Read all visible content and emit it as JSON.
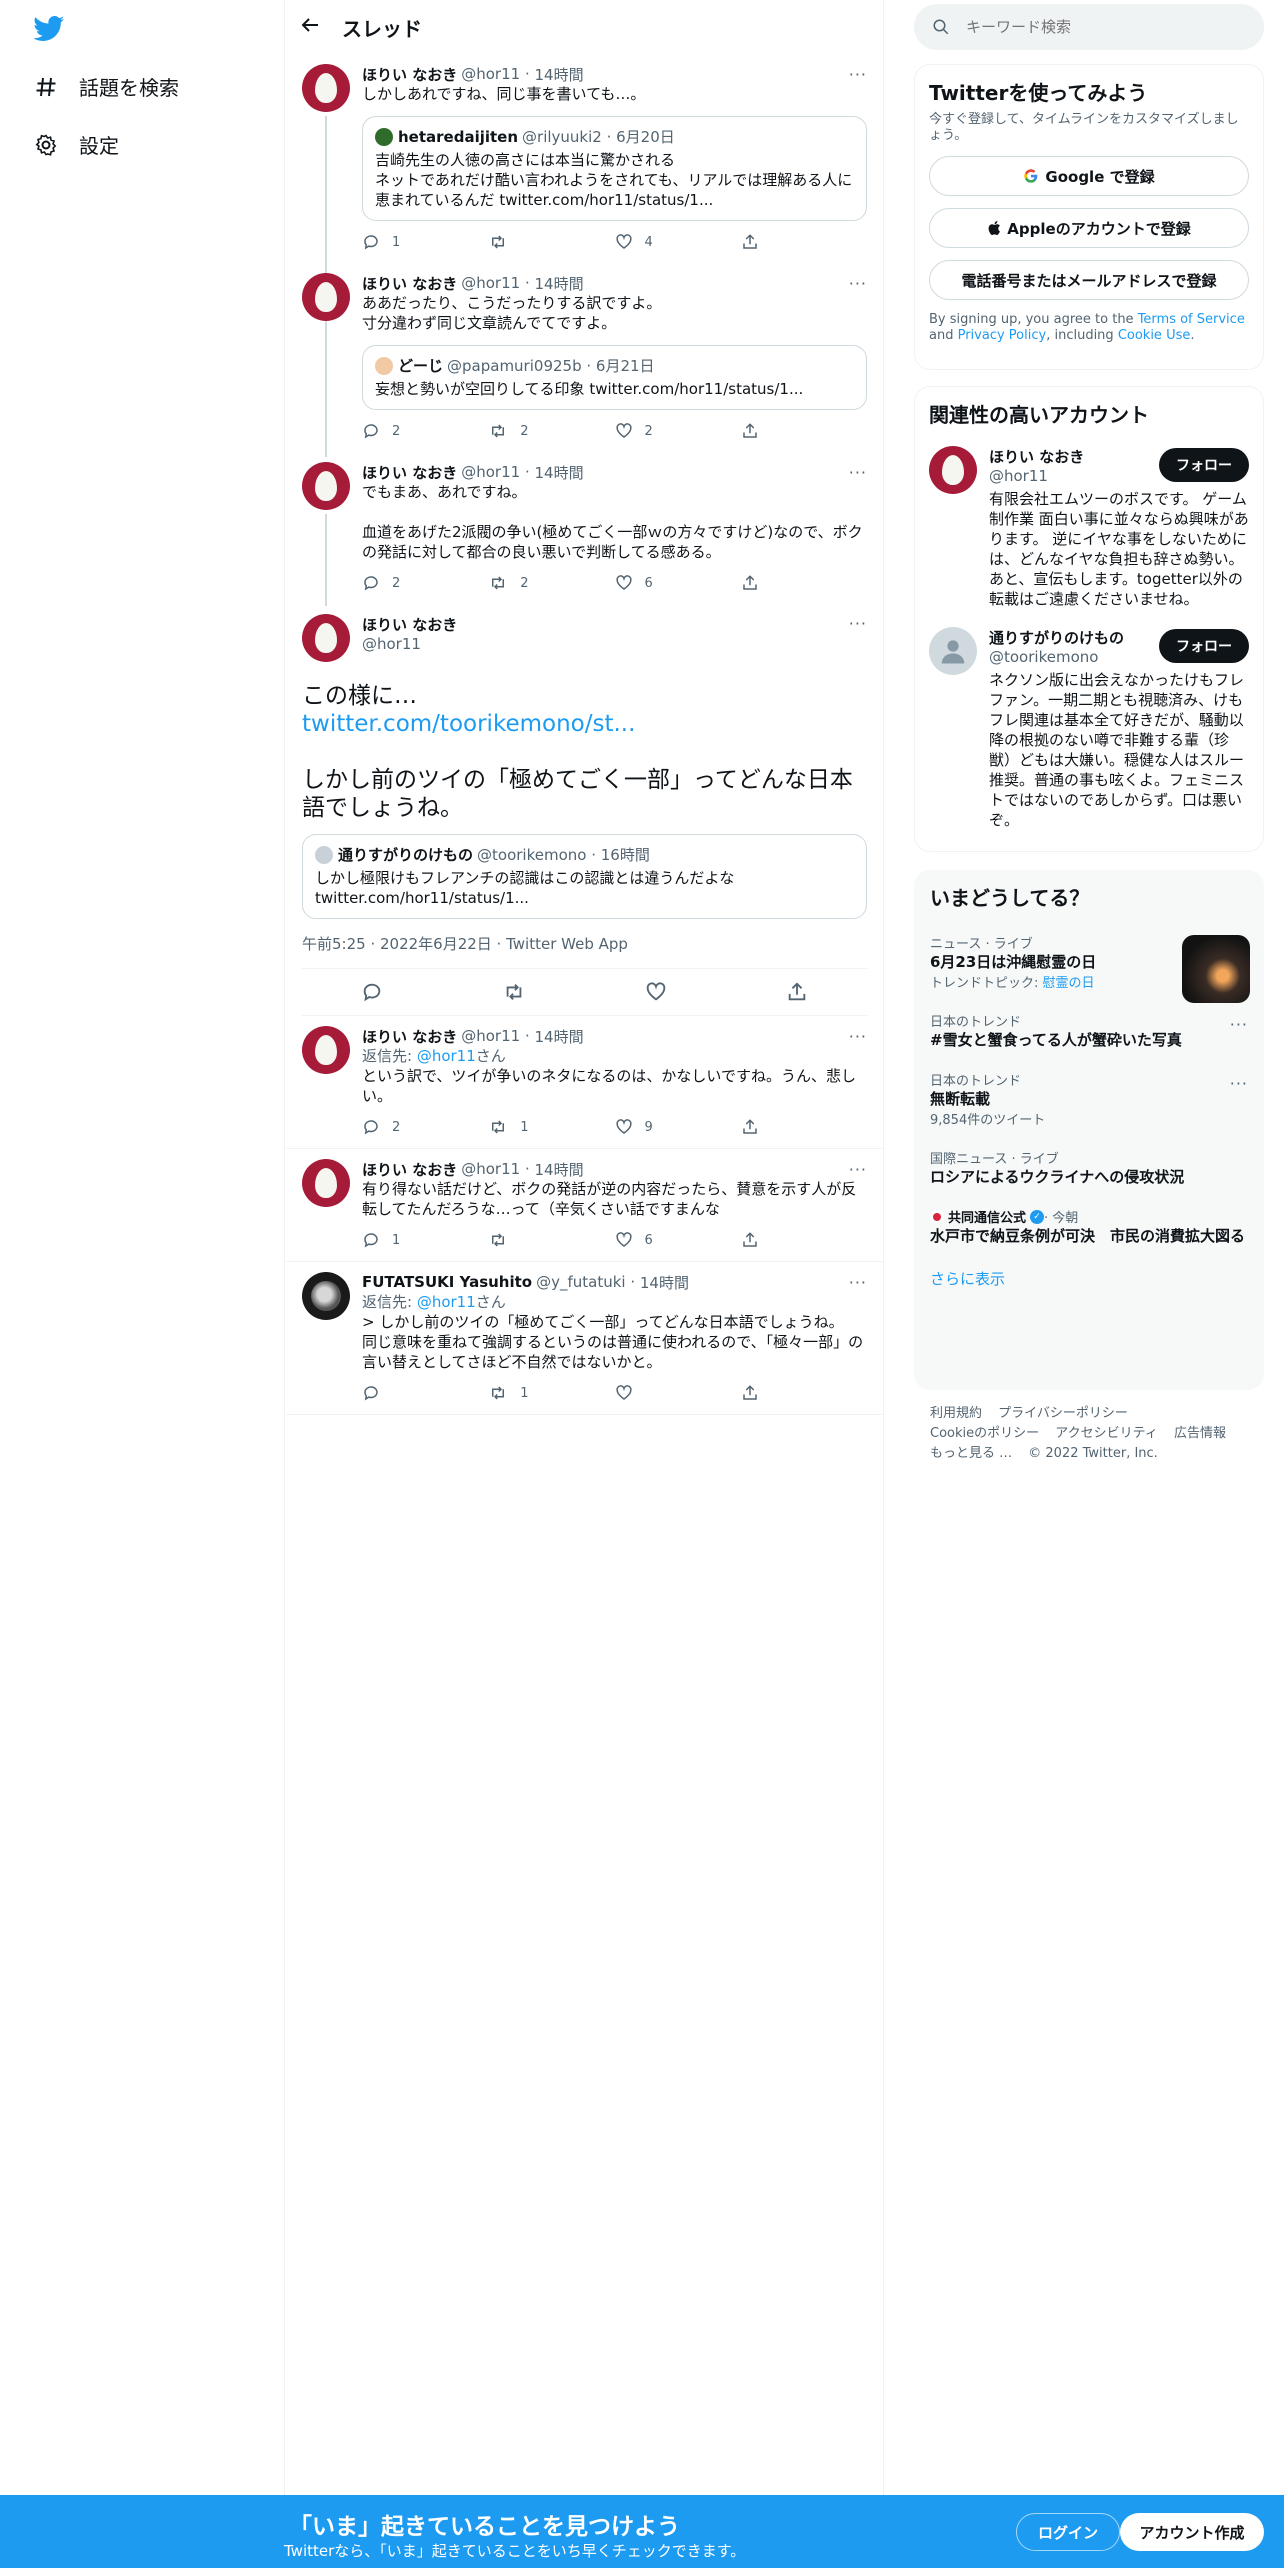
{
  "nav": {
    "explore_label": "話題を検索",
    "settings_label": "設定"
  },
  "header": {
    "title": "スレッド"
  },
  "thread": [
    {
      "name": "ほりい なおき",
      "handle": "@hor11",
      "time": "14時間",
      "text": "しかしあれですね、同じ事を書いても…。",
      "quote": {
        "name": "hetaredaijiten",
        "handle": "@rilyuuki2",
        "time": "6月20日",
        "text": "吉崎先生の人徳の高さには本当に驚かされる\nネットであれだけ酷い言われようをされても、リアルでは理解ある人に恵まれているんだ twitter.com/hor11/status/1..."
      },
      "replies": "1",
      "retweets": "",
      "likes": "4"
    },
    {
      "name": "ほりい なおき",
      "handle": "@hor11",
      "time": "14時間",
      "text": "ああだったり、こうだったりする訳ですよ。\n寸分違わず同じ文章読んでてですよ。",
      "quote": {
        "name": "どーじ",
        "handle": "@papamuri0925b",
        "time": "6月21日",
        "text": "妄想と勢いが空回りしてる印象 twitter.com/hor11/status/1..."
      },
      "replies": "2",
      "retweets": "2",
      "likes": "2"
    },
    {
      "name": "ほりい なおき",
      "handle": "@hor11",
      "time": "14時間",
      "text": "でもまあ、あれですね。\n\n血道をあげた2派閥の争い(極めてごく一部ｗの方々ですけど)なので、ボクの発話に対して都合の良い悪いで判断してる感ある。",
      "replies": "2",
      "retweets": "2",
      "likes": "6"
    }
  ],
  "focal": {
    "name": "ほりい なおき",
    "handle": "@hor11",
    "text1": "この様に…",
    "link": "twitter.com/toorikemono/st...",
    "text2": "しかし前のツイの「極めてごく一部」ってどんな日本語でしょうね。",
    "quote": {
      "name": "通りすがりのけもの",
      "handle": "@toorikemono",
      "time": "16時間",
      "text": "しかし極限けもフレアンチの認識はこの認識とは違うんだよな twitter.com/hor11/status/1..."
    },
    "timestamp": "午前5:25 · 2022年6月22日 · Twitter Web App"
  },
  "replies": [
    {
      "name": "ほりい なおき",
      "handle": "@hor11",
      "time": "14時間",
      "reply_prefix": "返信先: ",
      "reply_to": "@hor11",
      "reply_suffix": "さん",
      "text": "という訳で、ツイが争いのネタになるのは、かなしいですね。うん、悲しい。",
      "replies": "2",
      "retweets": "1",
      "likes": "9"
    },
    {
      "name": "ほりい なおき",
      "handle": "@hor11",
      "time": "14時間",
      "text": "有り得ない話だけど、ボクの発話が逆の内容だったら、賛意を示す人が反転してたんだろうな…って（辛気くさい話ですまんな",
      "replies": "1",
      "retweets": "",
      "likes": "6"
    },
    {
      "name": "FUTATSUKI Yasuhito",
      "handle": "@y_futatuki",
      "time": "14時間",
      "reply_prefix": "返信先: ",
      "reply_to": "@hor11",
      "reply_suffix": "さん",
      "text": "> しかし前のツイの「極めてごく一部」ってどんな日本語でしょうね。\n同じ意味を重ねて強調するというのは普通に使われるので、「極々一部」の言い替えとしてさほど不自然ではないかと。",
      "replies": "",
      "retweets": "1",
      "likes": ""
    }
  ],
  "search": {
    "placeholder": "キーワード検索"
  },
  "signup": {
    "title": "Twitterを使ってみよう",
    "sub": "今すぐ登録して、タイムラインをカスタマイズしましょう。",
    "google": "Google で登録",
    "apple": "Appleのアカウントで登録",
    "phone": "電話番号またはメールアドレスで登録",
    "fine1": "By signing up, you agree to the ",
    "terms": "Terms of Service",
    "fine2": " and ",
    "privacy": "Privacy Policy",
    "fine3": ", including ",
    "cookie": "Cookie Use",
    "fine4": "."
  },
  "related": {
    "title": "関連性の高いアカウント",
    "accounts": [
      {
        "name": "ほりい なおき",
        "handle": "@hor11",
        "follow": "フォロー",
        "bio": "有限会社エムツーのボスです。 ゲーム制作業 面白い事に並々ならぬ興味があります。 逆にイヤな事をしないためには、どんなイヤな負担も辞さぬ勢い。あと、宣伝もします。togetter以外の転載はご遠慮くださいませね。"
      },
      {
        "name": "通りすがりのけもの",
        "handle": "@toorikemono",
        "follow": "フォロー",
        "bio": "ネクソン版に出会えなかったけもフレファン。一期二期とも視聴済み、けもフレ関連は基本全て好きだが、騒動以降の根拠のない噂で非難する輩（珍獣）どもは大嫌い。穏健な人はスルー推奨。普通の事も呟くよ。フェミニストではないのであしからず。口は悪いぞ。"
      }
    ]
  },
  "trends": {
    "title": "いまどうしてる？",
    "items": [
      {
        "context": "ニュース · ライブ",
        "name": "6月23日は沖縄慰霊の日",
        "sub_prefix": "トレンドトピック: ",
        "sub_link": "慰霊の日"
      },
      {
        "context": "日本のトレンド",
        "name": "#雪女と蟹食ってる人が蟹砕いた写真"
      },
      {
        "context": "日本のトレンド",
        "name": "無断転載",
        "sub_prefix": "9,854件のツイート"
      },
      {
        "context": "国際ニュース · ライブ",
        "name": "ロシアによるウクライナへの侵攻状況"
      },
      {
        "context": "共同通信公式",
        "context_suffix": " · 今朝",
        "name": "水戸市で納豆条例が可決　市民の消費拡大図る"
      }
    ],
    "show_more": "さらに表示"
  },
  "footer": {
    "links": [
      "利用規約",
      "プライバシーポリシー",
      "Cookieのポリシー",
      "アクセシビリティ",
      "広告情報",
      "もっと見る …"
    ],
    "copyright": "© 2022 Twitter, Inc."
  },
  "bottom": {
    "title": "「いま」起きていることを見つけよう",
    "sub": "Twitterなら、「いま」起きていることをいち早くチェックできます。",
    "login": "ログイン",
    "create": "アカウント作成"
  },
  "colors": {
    "accent": "#1d9bf0",
    "avatar": "#a51b38"
  }
}
